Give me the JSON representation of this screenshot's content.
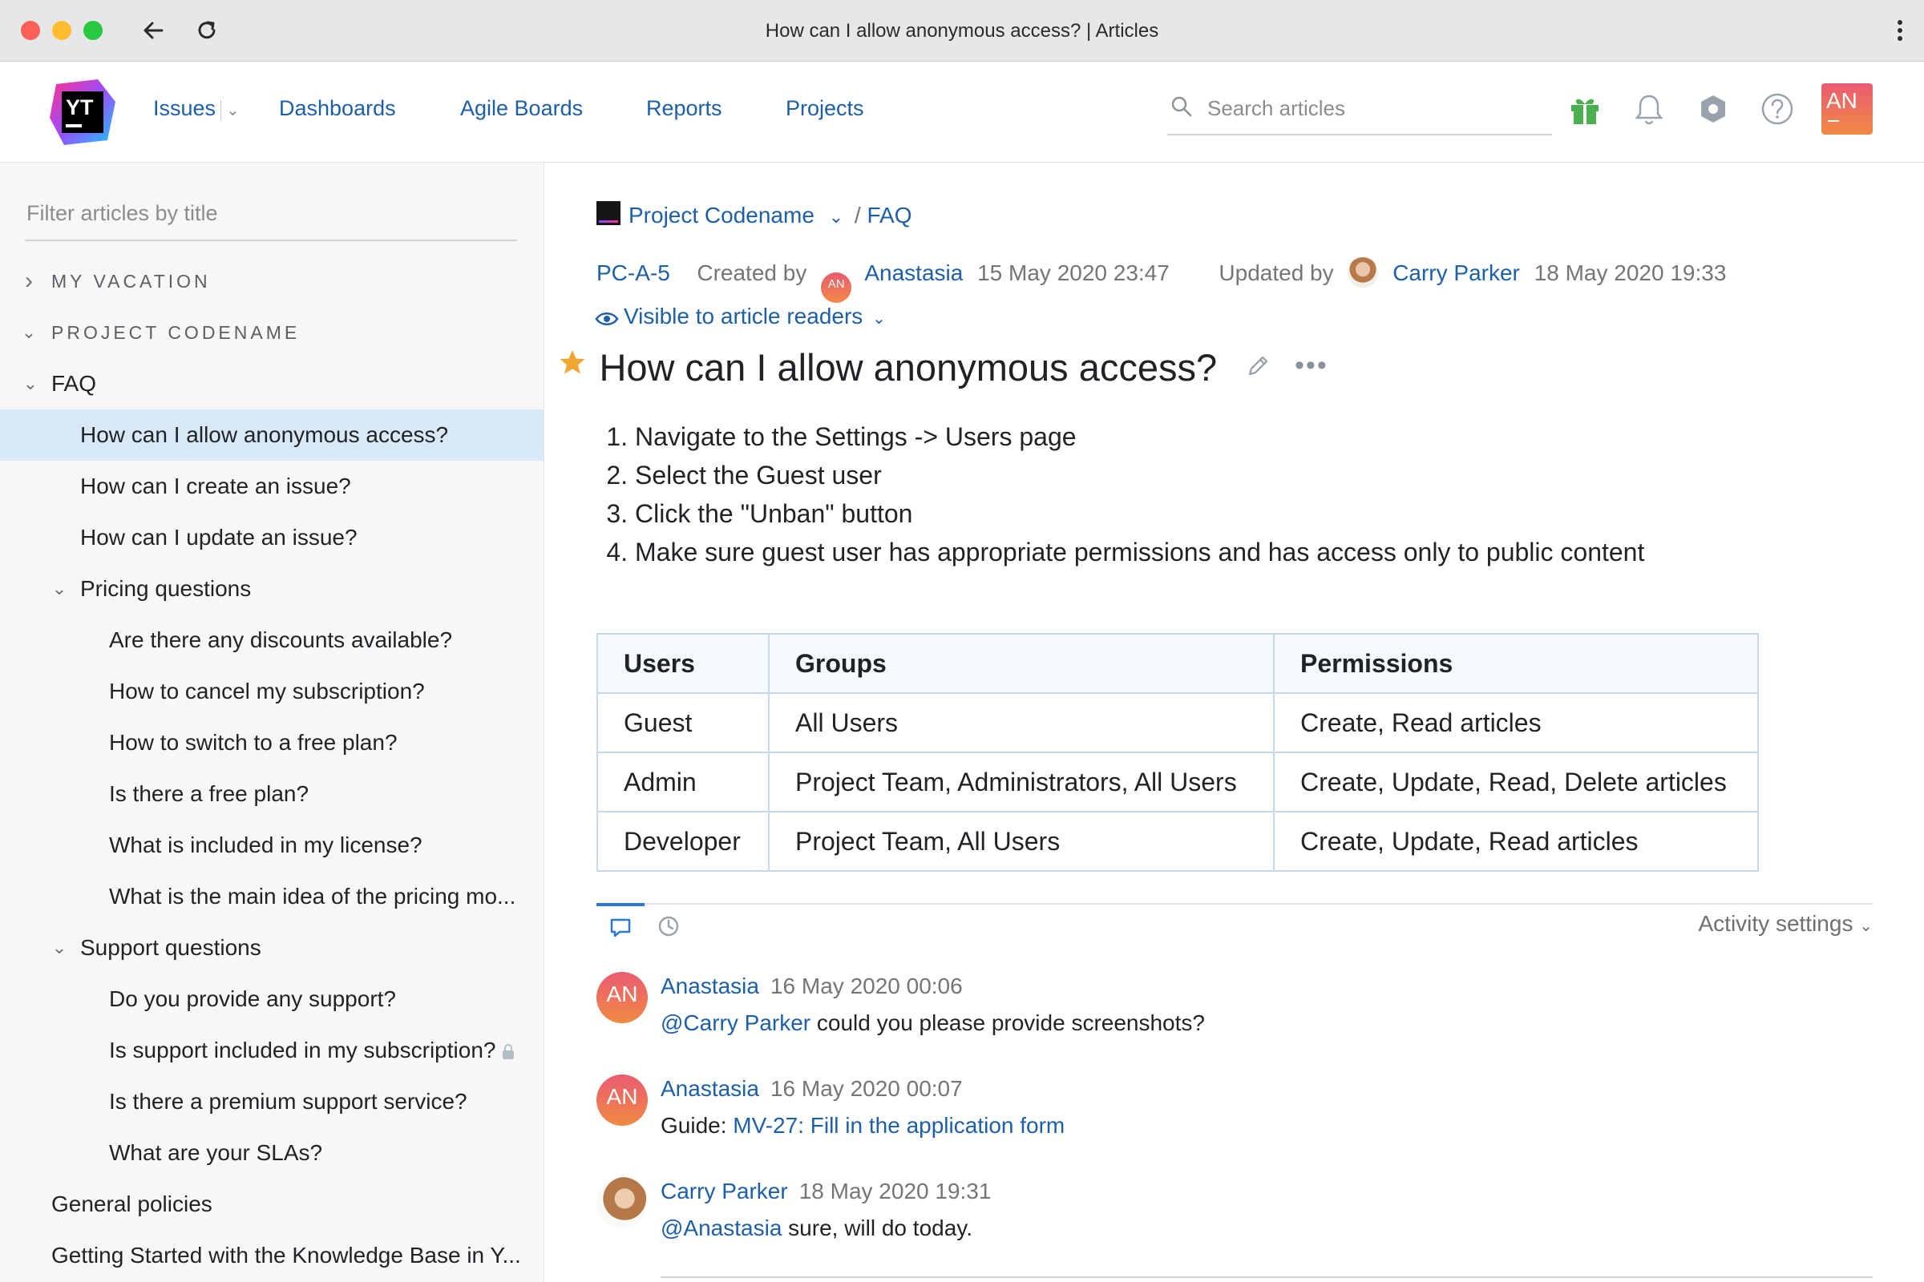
{
  "window": {
    "title": "How can I allow anonymous access? | Articles"
  },
  "header": {
    "logo_text": "YT",
    "nav": [
      {
        "label": "Issues"
      },
      {
        "label": "Dashboards"
      },
      {
        "label": "Agile Boards"
      },
      {
        "label": "Reports"
      },
      {
        "label": "Projects"
      }
    ],
    "search_placeholder": "Search articles",
    "user_initials": "AN",
    "icons": [
      "gift-icon",
      "bell-icon",
      "settings-icon",
      "help-icon"
    ]
  },
  "sidebar": {
    "filter_placeholder": "Filter articles by title",
    "tree": [
      {
        "label": "MY VACATION",
        "type": "section",
        "level": 0,
        "toggle": "collapsed"
      },
      {
        "label": "PROJECT CODENAME",
        "type": "section",
        "level": 0,
        "toggle": "expanded"
      },
      {
        "label": "FAQ",
        "level": 0,
        "toggle": "expanded"
      },
      {
        "label": "How can I allow anonymous access?",
        "level": 1,
        "selected": true
      },
      {
        "label": "How can I create an issue?",
        "level": 1
      },
      {
        "label": "How can I update an issue?",
        "level": 1
      },
      {
        "label": "Pricing questions",
        "level": 1,
        "toggle": "expanded"
      },
      {
        "label": "Are there any discounts available?",
        "level": 2
      },
      {
        "label": "How to cancel my subscription?",
        "level": 2
      },
      {
        "label": "How to switch to a free plan?",
        "level": 2
      },
      {
        "label": "Is there a free plan?",
        "level": 2
      },
      {
        "label": "What is included in my license?",
        "level": 2
      },
      {
        "label": "What is the main idea of the pricing mo...",
        "level": 2
      },
      {
        "label": "Support questions",
        "level": 1,
        "toggle": "expanded"
      },
      {
        "label": "Do you provide any support?",
        "level": 2
      },
      {
        "label": "Is support included in my subscription?",
        "level": 2,
        "locked": true
      },
      {
        "label": "Is there a premium support service?",
        "level": 2
      },
      {
        "label": "What are your SLAs?",
        "level": 2
      },
      {
        "label": "General policies",
        "level": 0
      },
      {
        "label": "Getting Started with the Knowledge Base in Y...",
        "level": 0
      }
    ]
  },
  "article": {
    "breadcrumb": {
      "project": "Project Codename",
      "separator": "/",
      "page": "FAQ"
    },
    "id": "PC-A-5",
    "created_label": "Created by",
    "author": "Anastasia",
    "author_initials": "AN",
    "created_date": "15 May 2020 23:47",
    "updated_label": "Updated by",
    "updater": "Carry Parker",
    "updated_date": "18 May 2020 19:33",
    "visibility": "Visible to article readers",
    "title": "How can I allow anonymous access?",
    "steps": [
      "Navigate to the Settings -> Users page",
      "Select the Guest user",
      "Click the \"Unban\" button",
      "Make sure guest user has appropriate permissions and has access only to public content"
    ],
    "table": {
      "headers": [
        "Users",
        "Groups",
        "Permissions"
      ],
      "rows": [
        [
          "Guest",
          "All Users",
          "Create, Read articles"
        ],
        [
          "Admin",
          "Project Team, Administrators, All Users",
          "Create, Update, Read, Delete articles"
        ],
        [
          "Developer",
          "Project Team, All Users",
          "Create, Update, Read articles"
        ]
      ]
    }
  },
  "activity": {
    "settings_label": "Activity settings",
    "comments": [
      {
        "author": "Anastasia",
        "initials": "AN",
        "date": "16 May 2020 00:06",
        "mention": "@Carry Parker",
        "text": " could you please provide screenshots?"
      },
      {
        "author": "Anastasia",
        "initials": "AN",
        "date": "16 May 2020 00:07",
        "prefix": "Guide: ",
        "link": "MV-27: Fill in the application form"
      },
      {
        "author": "Carry Parker",
        "initials": "",
        "date": "18 May 2020 19:31",
        "mention": "@Anastasia",
        "text": " sure, will do today."
      }
    ]
  },
  "colors": {
    "link": "#1d5fa8",
    "selected_row": "#d9e8f6",
    "star": "#f0a732",
    "avatar_top": "#ea5b71",
    "avatar_bottom": "#f08a45"
  }
}
